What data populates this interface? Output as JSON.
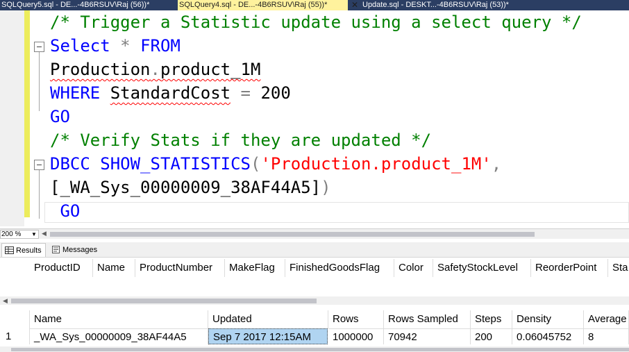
{
  "tabs": [
    {
      "label": "SQLQuery5.sql - DE...-4B6RSUV\\Raj (56))*",
      "active": false
    },
    {
      "label": "SQLQuery4.sql - DE...-4B6RSUV\\Raj (55))*",
      "active": true
    },
    {
      "label": "Update.sql - DESKT...-4B6RSUV\\Raj (53))*",
      "active": false
    }
  ],
  "tab_close_glyph": "✕",
  "editor": {
    "lines": [
      {
        "parts": [
          {
            "t": "/* Trigger a Statistic update using a select query */",
            "c": "c"
          }
        ]
      },
      {
        "parts": [
          {
            "t": "Select",
            "c": "k"
          },
          {
            "t": " ",
            "c": "t"
          },
          {
            "t": "*",
            "c": "g"
          },
          {
            "t": " ",
            "c": "t"
          },
          {
            "t": "FROM",
            "c": "k"
          }
        ]
      },
      {
        "parts": [
          {
            "t": "Production",
            "c": "t sq"
          },
          {
            "t": ".",
            "c": "g sq"
          },
          {
            "t": "product_1M",
            "c": "t sq"
          }
        ]
      },
      {
        "parts": [
          {
            "t": "WHERE",
            "c": "k"
          },
          {
            "t": " ",
            "c": "t"
          },
          {
            "t": "StandardCost",
            "c": "t sq"
          },
          {
            "t": " ",
            "c": "t"
          },
          {
            "t": "=",
            "c": "g"
          },
          {
            "t": " 200",
            "c": "t"
          }
        ]
      },
      {
        "parts": [
          {
            "t": "GO",
            "c": "k"
          }
        ]
      },
      {
        "parts": [
          {
            "t": "/* Verify Stats if they are updated */",
            "c": "c"
          }
        ]
      },
      {
        "parts": [
          {
            "t": "DBCC",
            "c": "k"
          },
          {
            "t": " ",
            "c": "t"
          },
          {
            "t": "SHOW_STATISTICS",
            "c": "k"
          },
          {
            "t": "(",
            "c": "g"
          },
          {
            "t": "'Production.product_1M'",
            "c": "s"
          },
          {
            "t": ",",
            "c": "g"
          }
        ]
      },
      {
        "parts": [
          {
            "t": "[_WA_Sys_00000009_38AF44A5]",
            "c": "t"
          },
          {
            "t": ")",
            "c": "g"
          }
        ]
      },
      {
        "parts": [
          {
            "t": " GO",
            "c": "k"
          }
        ]
      }
    ]
  },
  "zoom": "200 %",
  "results_tabs": [
    {
      "label": "Results",
      "icon": "grid-icon",
      "active": true
    },
    {
      "label": "Messages",
      "icon": "messages-icon",
      "active": false
    }
  ],
  "grid1": {
    "columns": [
      "ProductID",
      "Name",
      "ProductNumber",
      "MakeFlag",
      "FinishedGoodsFlag",
      "Color",
      "SafetyStockLevel",
      "ReorderPoint",
      "Sta"
    ]
  },
  "grid2": {
    "columns": [
      "Name",
      "Updated",
      "Rows",
      "Rows Sampled",
      "Steps",
      "Density",
      "Average"
    ],
    "rows": [
      {
        "num": "1",
        "cells": [
          "_WA_Sys_00000009_38AF44A5",
          "Sep  7 2017 12:15AM",
          "1000000",
          "70942",
          "200",
          "0.06045752",
          "8"
        ]
      }
    ],
    "selected_cell": 1
  }
}
